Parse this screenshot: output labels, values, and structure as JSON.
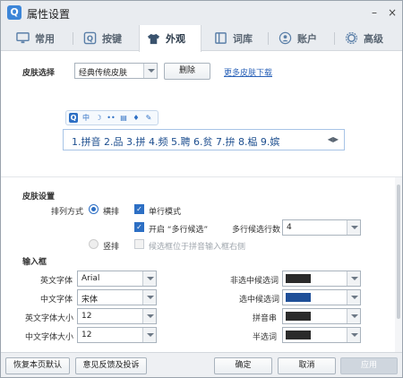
{
  "window": {
    "title": "属性设置",
    "minimize_label": "–",
    "close_label": "×"
  },
  "tabs": [
    {
      "label": "常用",
      "icon": "monitor-icon"
    },
    {
      "label": "按键",
      "icon": "key-icon"
    },
    {
      "label": "外观",
      "icon": "shirt-icon"
    },
    {
      "label": "词库",
      "icon": "book-icon"
    },
    {
      "label": "账户",
      "icon": "user-icon"
    },
    {
      "label": "高级",
      "icon": "gear-icon"
    }
  ],
  "skin": {
    "label": "皮肤选择",
    "selected": "经典传统皮肤",
    "delete_label": "删除",
    "more_link": "更多皮肤下载"
  },
  "preview": {
    "candidates": "1.拼音 2.品 3.拼 4.频 5.聘 6.贫 7.拚 8.榀 9.嫔",
    "toolbar_icons": [
      "Q",
      "中",
      "☽",
      "••",
      "▤",
      "♦",
      "✎"
    ],
    "arrows": "◀▶"
  },
  "skin_settings": {
    "section_label": "皮肤设置",
    "layout_label": "排列方式",
    "horizontal_label": "横排",
    "vertical_label": "竖排",
    "single_row_label": "单行模式",
    "multi_cand_label": "开启 “多行候选”",
    "multi_rows_label": "多行候选行数",
    "multi_rows_value": "4",
    "cand_below_label": "候选框位于拼音输入框右侧"
  },
  "input_box": {
    "section_label": "输入框",
    "en_font_label": "英文字体",
    "en_font_value": "Arial",
    "cn_font_label": "中文字体",
    "cn_font_value": "宋体",
    "en_size_label": "英文字体大小",
    "en_size_value": "12",
    "cn_size_label": "中文字体大小",
    "cn_size_value": "12",
    "unselected_label": "非选中候选词",
    "selected_label": "选中候选词",
    "pinyin_label": "拼音串",
    "half_selected_label": "半选词",
    "colors": {
      "unselected": "#2b2b2b",
      "selected": "#1f4f98",
      "pinyin": "#2b2b2b",
      "half_selected": "#2b2b2b"
    }
  },
  "footer": {
    "restore_label": "恢复本页默认",
    "feedback_label": "意见反馈及投诉",
    "ok_label": "确定",
    "cancel_label": "取消",
    "apply_label": "应用"
  },
  "colors": {
    "accent": "#2d6fc4",
    "titlebar": "#e9ecf0"
  }
}
